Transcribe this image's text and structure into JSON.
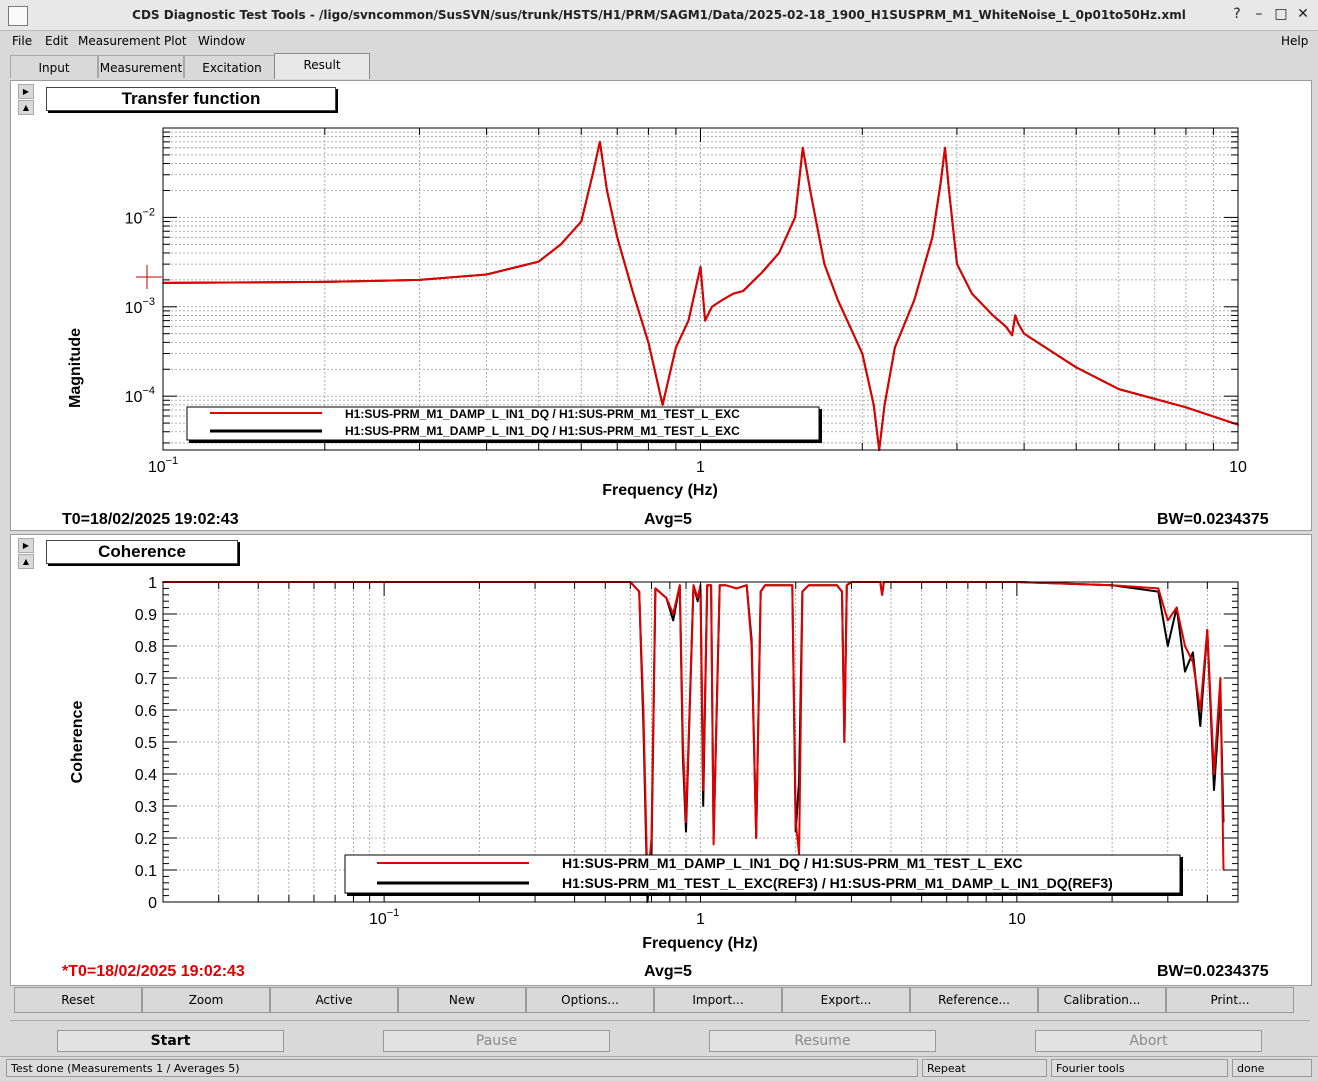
{
  "window": {
    "title": "CDS Diagnostic Test Tools - /ligo/svncommon/SusSVN/sus/trunk/HSTS/H1/PRM/SAGM1/Data/2025-02-18_1900_H1SUSPRM_M1_WhiteNoise_L_0p01to50Hz.xml",
    "controls": {
      "help": "?",
      "minimize": "–",
      "maximize": "□",
      "close": "✕"
    }
  },
  "menu": {
    "file": "File",
    "edit": "Edit",
    "measurement": "Measurement",
    "plot": "Plot",
    "window": "Window",
    "help": "Help"
  },
  "tabs": [
    {
      "label": "Input"
    },
    {
      "label": "Measurement"
    },
    {
      "label": "Excitation"
    },
    {
      "label": "Result",
      "active": true
    }
  ],
  "top_plot": {
    "title": "Transfer function",
    "t0": "T0=18/02/2025 19:02:43",
    "avg": "Avg=5",
    "bw": "BW=0.0234375"
  },
  "bottom_plot": {
    "title": "Coherence",
    "t0": "*T0=18/02/2025 19:02:43",
    "avg": "Avg=5",
    "bw": "BW=0.0234375"
  },
  "chart_data": [
    {
      "type": "line",
      "title": "Transfer function",
      "xlabel": "Frequency (Hz)",
      "ylabel": "Magnitude",
      "x_scale": "log",
      "y_scale": "log",
      "xlim": [
        0.1,
        10
      ],
      "ylim": [
        2.5e-05,
        0.1
      ],
      "x_ticks": [
        {
          "value": 0.1,
          "base": "10",
          "exp": "−1"
        },
        {
          "value": 1,
          "base": "1",
          "exp": ""
        },
        {
          "value": 10,
          "base": "10",
          "exp": ""
        }
      ],
      "y_ticks": [
        {
          "value": 0.01,
          "base": "10",
          "exp": "−2"
        },
        {
          "value": 0.001,
          "base": "10",
          "exp": "−3"
        },
        {
          "value": 0.0001,
          "base": "10",
          "exp": "−4"
        }
      ],
      "grid": true,
      "legend_position": "bottom-left",
      "series": [
        {
          "name": "H1:SUS-PRM_M1_DAMP_L_IN1_DQ / H1:SUS-PRM_M1_TEST_L_EXC",
          "color": "#e00000",
          "x": [
            0.1,
            0.2,
            0.3,
            0.4,
            0.5,
            0.55,
            0.6,
            0.63,
            0.65,
            0.67,
            0.7,
            0.75,
            0.8,
            0.85,
            0.9,
            0.95,
            1.0,
            1.02,
            1.05,
            1.1,
            1.15,
            1.2,
            1.3,
            1.4,
            1.5,
            1.55,
            1.6,
            1.7,
            1.8,
            2.0,
            2.1,
            2.15,
            2.2,
            2.3,
            2.5,
            2.7,
            2.8,
            2.85,
            2.9,
            3.0,
            3.2,
            3.5,
            3.7,
            3.8,
            3.85,
            3.9,
            4.0,
            5.0,
            6.0,
            8.0,
            10.0
          ],
          "y": [
            0.00185,
            0.0019,
            0.002,
            0.0023,
            0.0032,
            0.005,
            0.009,
            0.03,
            0.07,
            0.02,
            0.006,
            0.0014,
            0.0004,
            8e-05,
            0.00035,
            0.0007,
            0.0028,
            0.0007,
            0.001,
            0.0012,
            0.0014,
            0.0015,
            0.0024,
            0.004,
            0.01,
            0.06,
            0.02,
            0.003,
            0.0012,
            0.0003,
            8e-05,
            2e-05,
            8e-05,
            0.00035,
            0.0012,
            0.006,
            0.025,
            0.06,
            0.02,
            0.003,
            0.0014,
            0.0008,
            0.0006,
            0.00048,
            0.0008,
            0.00065,
            0.0005,
            0.00021,
            0.00012,
            7.5e-05,
            4.8e-05
          ]
        },
        {
          "name": "H1:SUS-PRM_M1_DAMP_L_IN1_DQ / H1:SUS-PRM_M1_TEST_L_EXC",
          "color": "#000000",
          "x": [
            0.1,
            0.2,
            0.3,
            0.4,
            0.5,
            0.55,
            0.6,
            0.63,
            0.65,
            0.67,
            0.7,
            0.75,
            0.8,
            0.85,
            0.9,
            0.95,
            1.0,
            1.02,
            1.05,
            1.1,
            1.15,
            1.2,
            1.3,
            1.4,
            1.5,
            1.55,
            1.6,
            1.7,
            1.8,
            2.0,
            2.1,
            2.15,
            2.2,
            2.3,
            2.5,
            2.7,
            2.8,
            2.85,
            2.9,
            3.0,
            3.2,
            3.5,
            3.7,
            3.8,
            3.85,
            3.9,
            4.0,
            5.0,
            6.0,
            8.0,
            10.0
          ],
          "y": [
            0.00185,
            0.0019,
            0.002,
            0.0023,
            0.0032,
            0.005,
            0.009,
            0.03,
            0.07,
            0.02,
            0.006,
            0.0014,
            0.0004,
            8e-05,
            0.00035,
            0.0007,
            0.0028,
            0.0007,
            0.001,
            0.0012,
            0.0014,
            0.0015,
            0.0024,
            0.004,
            0.01,
            0.06,
            0.02,
            0.003,
            0.0012,
            0.0003,
            8e-05,
            2e-05,
            8e-05,
            0.00035,
            0.0012,
            0.006,
            0.025,
            0.06,
            0.02,
            0.003,
            0.0014,
            0.0008,
            0.0006,
            0.00048,
            0.0008,
            0.00065,
            0.0005,
            0.00021,
            0.00012,
            7.5e-05,
            4.8e-05
          ]
        }
      ]
    },
    {
      "type": "line",
      "title": "Coherence",
      "xlabel": "Frequency (Hz)",
      "ylabel": "Coherence",
      "x_scale": "log",
      "y_scale": "linear",
      "xlim": [
        0.02,
        50
      ],
      "ylim": [
        0,
        1
      ],
      "x_ticks": [
        {
          "value": 0.1,
          "base": "10",
          "exp": "−1"
        },
        {
          "value": 1,
          "base": "1",
          "exp": ""
        },
        {
          "value": 10,
          "base": "10",
          "exp": ""
        }
      ],
      "y_ticks": [
        0,
        0.1,
        0.2,
        0.3,
        0.4,
        0.5,
        0.6,
        0.7,
        0.8,
        0.9,
        1
      ],
      "grid": true,
      "legend_position": "bottom-right",
      "series": [
        {
          "name": "H1:SUS-PRM_M1_DAMP_L_IN1_DQ / H1:SUS-PRM_M1_TEST_L_EXC",
          "color": "#e00000",
          "x": [
            0.02,
            0.6,
            0.64,
            0.66,
            0.68,
            0.7,
            0.72,
            0.78,
            0.82,
            0.86,
            0.88,
            0.9,
            0.95,
            0.98,
            1.0,
            1.02,
            1.05,
            1.08,
            1.1,
            1.15,
            1.2,
            1.3,
            1.4,
            1.45,
            1.5,
            1.55,
            1.6,
            1.8,
            1.95,
            2.0,
            2.05,
            2.1,
            2.2,
            2.5,
            2.7,
            2.8,
            2.85,
            2.9,
            3.0,
            3.5,
            3.7,
            3.75,
            3.8,
            4.0,
            10.0,
            20.0,
            28.0,
            30.0,
            32.0,
            34.0,
            36.0,
            38.0,
            40.0,
            42.0,
            44.0,
            45.0
          ],
          "y": [
            1,
            1,
            0.97,
            0.6,
            0.05,
            0.2,
            0.98,
            0.95,
            0.9,
            0.99,
            0.5,
            0.25,
            0.99,
            0.95,
            0.99,
            0.35,
            0.99,
            0.99,
            0.18,
            0.99,
            0.99,
            0.98,
            0.99,
            0.8,
            0.2,
            0.97,
            0.99,
            0.99,
            0.99,
            0.25,
            0.15,
            0.97,
            0.99,
            0.99,
            0.99,
            0.97,
            0.5,
            0.99,
            1,
            1,
            1,
            0.96,
            1,
            1,
            1,
            0.99,
            0.98,
            0.88,
            0.92,
            0.8,
            0.75,
            0.6,
            0.85,
            0.4,
            0.7,
            0.1
          ]
        },
        {
          "name": "H1:SUS-PRM_M1_TEST_L_EXC(REF3) / H1:SUS-PRM_M1_DAMP_L_IN1_DQ(REF3)",
          "color": "#000000",
          "x": [
            0.02,
            0.6,
            0.64,
            0.66,
            0.68,
            0.7,
            0.72,
            0.78,
            0.82,
            0.86,
            0.88,
            0.9,
            0.95,
            0.98,
            1.0,
            1.02,
            1.05,
            1.08,
            1.1,
            1.15,
            1.2,
            1.3,
            1.4,
            1.45,
            1.5,
            1.55,
            1.6,
            1.8,
            1.95,
            2.0,
            2.05,
            2.1,
            2.2,
            2.5,
            2.7,
            2.8,
            2.85,
            2.9,
            3.0,
            3.5,
            3.7,
            3.75,
            3.8,
            4.0,
            10.0,
            20.0,
            28.0,
            30.0,
            32.0,
            34.0,
            36.0,
            38.0,
            40.0,
            42.0,
            44.0,
            45.0
          ],
          "y": [
            1,
            1,
            0.97,
            0.55,
            0.0,
            0.15,
            0.98,
            0.95,
            0.88,
            0.99,
            0.45,
            0.22,
            0.99,
            0.94,
            0.99,
            0.3,
            0.99,
            0.99,
            0.2,
            0.99,
            0.99,
            0.98,
            0.99,
            0.82,
            0.2,
            0.97,
            0.99,
            0.99,
            0.99,
            0.22,
            0.38,
            0.97,
            0.99,
            0.99,
            0.99,
            0.97,
            0.5,
            0.99,
            1,
            1,
            1,
            0.96,
            1,
            1,
            1,
            0.99,
            0.97,
            0.8,
            0.92,
            0.72,
            0.78,
            0.55,
            0.85,
            0.35,
            0.65,
            0.25
          ]
        }
      ]
    }
  ],
  "buttons": {
    "reset": "Reset",
    "zoom": "Zoom",
    "active": "Active",
    "new": "New",
    "options": "Options...",
    "import": "Import...",
    "export": "Export...",
    "reference": "Reference...",
    "calibration": "Calibration...",
    "print": "Print..."
  },
  "control": {
    "start": "Start",
    "pause": "Pause",
    "resume": "Resume",
    "abort": "Abort"
  },
  "status": {
    "message": "Test done (Measurements 1 / Averages 5)",
    "repeat": "Repeat",
    "tool": "Fourier tools",
    "state": "done"
  }
}
